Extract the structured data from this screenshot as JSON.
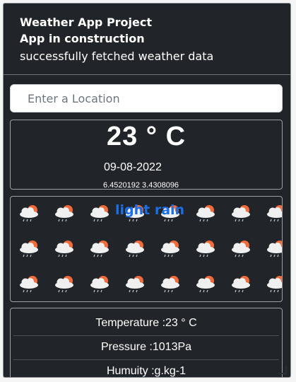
{
  "header": {
    "title": "Weather App Project",
    "subtitle": "App in construction",
    "status": "successfully fetched weather data"
  },
  "search": {
    "placeholder": "Enter a Location",
    "value": ""
  },
  "current": {
    "temperature": "23 ° C",
    "date": "09-08-2022",
    "coordinates": "6.4520192 3.4308096"
  },
  "condition": {
    "description": "light rain",
    "icon": "cloud-sun-rain-icon",
    "icon_count": 24,
    "colors": {
      "sun": "#f26b3a",
      "cloud": "#f0f0f0",
      "rain": "#b9bec6",
      "label": "#1a6fe6"
    }
  },
  "details": {
    "temperature": "Temperature :23 ° C",
    "pressure": "Pressure :1013Pa",
    "humidity": "Humuity :g.kg-1"
  },
  "theme": {
    "background": "#212529",
    "page": "#f5f5f5",
    "border": "#9aa0a6"
  }
}
